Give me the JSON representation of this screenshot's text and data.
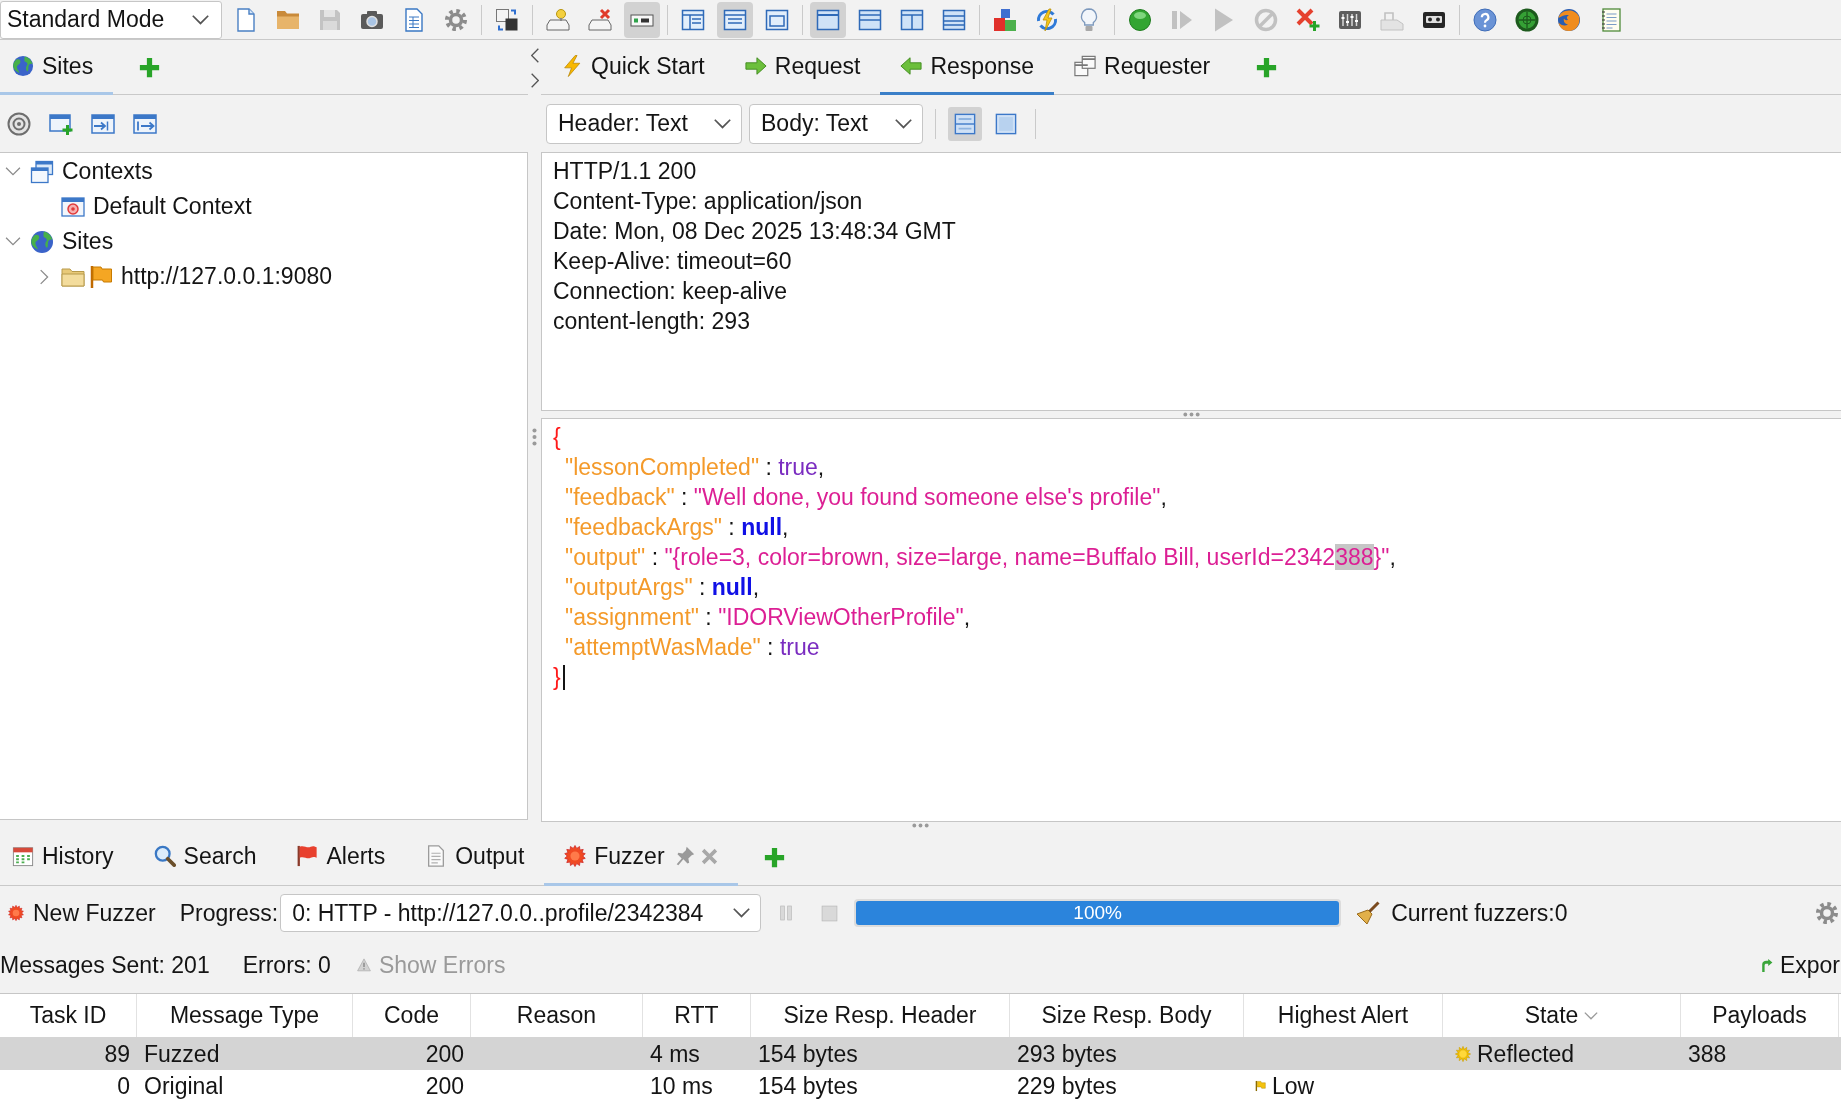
{
  "toolbar": {
    "mode": "Standard Mode",
    "groups": [
      [
        {
          "pressed": false,
          "disabled": false
        },
        {
          "pressed": false,
          "disabled": false
        },
        {
          "pressed": false,
          "disabled": true
        },
        {
          "pressed": false,
          "disabled": false
        },
        {
          "pressed": false,
          "disabled": false
        },
        {
          "pressed": false,
          "disabled": false
        }
      ],
      [
        {
          "pressed": false,
          "disabled": false
        }
      ],
      [
        {
          "pressed": false,
          "disabled": false
        },
        {
          "pressed": false,
          "disabled": false
        },
        {
          "pressed": true,
          "disabled": false
        }
      ],
      [
        {
          "pressed": false,
          "disabled": false
        },
        {
          "pressed": true,
          "disabled": false
        },
        {
          "pressed": false,
          "disabled": false
        }
      ],
      [
        {
          "pressed": true,
          "disabled": false
        },
        {
          "pressed": false,
          "disabled": false
        },
        {
          "pressed": false,
          "disabled": false
        },
        {
          "pressed": false,
          "disabled": false
        }
      ],
      [
        {
          "pressed": false,
          "disabled": false
        },
        {
          "pressed": false,
          "disabled": false
        },
        {
          "pressed": false,
          "disabled": false
        }
      ],
      [
        {
          "pressed": false,
          "disabled": false
        },
        {
          "pressed": false,
          "disabled": true
        },
        {
          "pressed": false,
          "disabled": true
        },
        {
          "pressed": false,
          "disabled": true
        },
        {
          "pressed": false,
          "disabled": false
        },
        {
          "pressed": false,
          "disabled": false
        },
        {
          "pressed": false,
          "disabled": true
        },
        {
          "pressed": false,
          "disabled": false
        }
      ],
      [
        {
          "pressed": false,
          "disabled": false
        },
        {
          "pressed": false,
          "disabled": false
        },
        {
          "pressed": false,
          "disabled": false
        },
        {
          "pressed": false,
          "disabled": false
        }
      ]
    ]
  },
  "sites_panel": {
    "focused": false,
    "tabs": [
      {
        "label": "Sites",
        "selected": true
      }
    ],
    "tree": [
      {
        "label": "Contexts",
        "expanded": true,
        "children": [
          {
            "label": "Default Context"
          }
        ]
      },
      {
        "label": "Sites",
        "expanded": true,
        "children": [
          {
            "label": "http://127.0.0.1:9080",
            "expanded": false
          }
        ]
      }
    ]
  },
  "work_panel": {
    "focused": true,
    "tabs": [
      {
        "label": "Quick Start",
        "selected": false
      },
      {
        "label": "Request",
        "selected": false
      },
      {
        "label": "Response",
        "selected": true
      },
      {
        "label": "Requester",
        "selected": false
      }
    ],
    "header_format": "Header: Text",
    "body_format": "Body: Text",
    "layout_buttons": [
      {
        "pressed": true
      },
      {
        "pressed": false
      }
    ],
    "header_lines": [
      "HTTP/1.1 200",
      "Content-Type: application/json",
      "Date: Mon, 08 Dec 2025 13:48:34 GMT",
      "Keep-Alive: timeout=60",
      "Connection: keep-alive",
      "content-length: 293"
    ],
    "body_lines": [
      {
        "tokens": [
          {
            "kind": "brace",
            "text": "{"
          }
        ],
        "children": [
          {
            "tokens": [
              {
                "kind": "key",
                "text": "\"lessonCompleted\""
              },
              {
                "kind": "punct",
                "text": " : "
              },
              {
                "kind": "boolean",
                "text": "true"
              },
              {
                "kind": "punct",
                "text": ","
              }
            ]
          },
          {
            "tokens": [
              {
                "kind": "key",
                "text": "\"feedback\""
              },
              {
                "kind": "punct",
                "text": " : "
              },
              {
                "kind": "string",
                "text": "\"Well done, you found someone else's profile\""
              },
              {
                "kind": "punct",
                "text": ","
              }
            ]
          },
          {
            "tokens": [
              {
                "kind": "key",
                "text": "\"feedbackArgs\""
              },
              {
                "kind": "punct",
                "text": " : "
              },
              {
                "kind": "null",
                "text": "null"
              },
              {
                "kind": "punct",
                "text": ","
              }
            ]
          },
          {
            "tokens": [
              {
                "kind": "key",
                "text": "\"output\""
              },
              {
                "kind": "punct",
                "text": " : "
              },
              {
                "kind": "string",
                "text": "\"{role=3, color=brown, size=large, name=Buffalo Bill, userId=2342"
              },
              {
                "kind": "match",
                "text": "388"
              },
              {
                "kind": "string",
                "text": "}\""
              },
              {
                "kind": "punct",
                "text": ","
              }
            ]
          },
          {
            "tokens": [
              {
                "kind": "key",
                "text": "\"outputArgs\""
              },
              {
                "kind": "punct",
                "text": " : "
              },
              {
                "kind": "null",
                "text": "null"
              },
              {
                "kind": "punct",
                "text": ","
              }
            ]
          },
          {
            "tokens": [
              {
                "kind": "key",
                "text": "\"assignment\""
              },
              {
                "kind": "punct",
                "text": " : "
              },
              {
                "kind": "string",
                "text": "\"IDORViewOtherProfile\""
              },
              {
                "kind": "punct",
                "text": ","
              }
            ]
          },
          {
            "tokens": [
              {
                "kind": "key",
                "text": "\"attemptWasMade\""
              },
              {
                "kind": "punct",
                "text": " : "
              },
              {
                "kind": "boolean",
                "text": "true"
              }
            ]
          }
        ]
      },
      {
        "tokens": [
          {
            "kind": "brace",
            "text": "}"
          }
        ]
      }
    ]
  },
  "bottom_panel": {
    "focused": false,
    "tabs": [
      {
        "label": "History",
        "selected": false,
        "closable": false
      },
      {
        "label": "Search",
        "selected": false,
        "closable": false
      },
      {
        "label": "Alerts",
        "selected": false,
        "closable": false
      },
      {
        "label": "Output",
        "selected": false,
        "closable": false
      },
      {
        "label": "Fuzzer",
        "selected": true,
        "closable": true
      }
    ],
    "fuzzer": {
      "new_fuzzer": "New Fuzzer",
      "progress_label": "Progress:",
      "progress_select": "0: HTTP - http://127.0.0..profile/2342384",
      "controls": [
        {
          "disabled": true
        },
        {
          "disabled": true
        }
      ],
      "progress": {
        "level": 1,
        "reading": "100%"
      },
      "current_fuzzers": "Current fuzzers:0",
      "messages_sent": "Messages Sent: 201",
      "errors": "Errors: 0",
      "show_errors": {
        "label": "Show Errors",
        "disabled": true
      },
      "export": "Expor"
    },
    "table": {
      "columns": [
        {
          "label": "Task ID",
          "sorted": false
        },
        {
          "label": "Message Type",
          "sorted": false
        },
        {
          "label": "Code",
          "sorted": false
        },
        {
          "label": "Reason",
          "sorted": false
        },
        {
          "label": "RTT",
          "sorted": false
        },
        {
          "label": "Size Resp. Header",
          "sorted": false
        },
        {
          "label": "Size Resp. Body",
          "sorted": false
        },
        {
          "label": "Highest Alert",
          "sorted": false
        },
        {
          "label": "State",
          "sorted": true
        },
        {
          "label": "Payloads",
          "sorted": false
        }
      ],
      "rows": [
        {
          "selected": true,
          "task_id": "89",
          "message_type": "Fuzzed",
          "code": "200",
          "rtt": "4 ms",
          "size_resp_header": "154 bytes",
          "size_resp_body": "293 bytes",
          "state": "Reflected",
          "payloads": "388"
        },
        {
          "selected": false,
          "task_id": "0",
          "message_type": "Original",
          "code": "200",
          "rtt": "10 ms",
          "size_resp_header": "154 bytes",
          "size_resp_body": "229 bytes",
          "highest_alert": "Low"
        }
      ]
    }
  }
}
